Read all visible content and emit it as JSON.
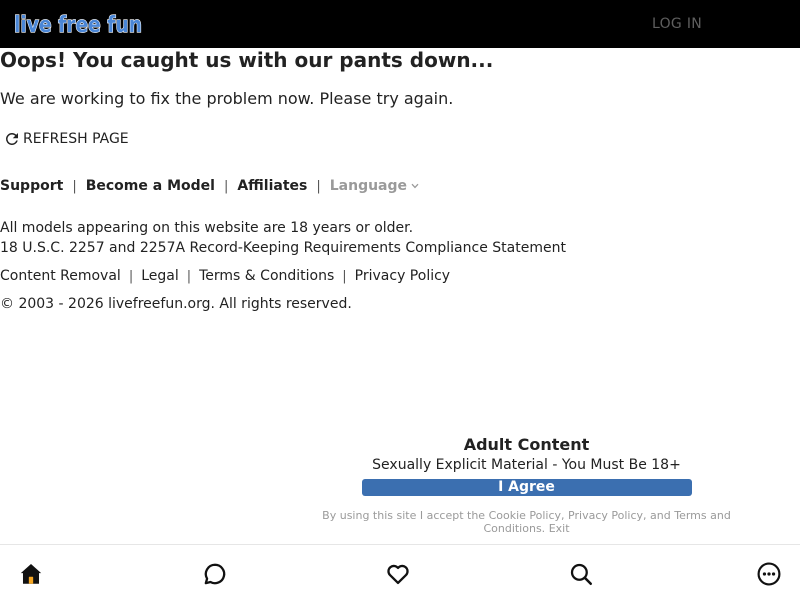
{
  "header": {
    "logo_text": "live free fun",
    "login_label": "LOG IN"
  },
  "error": {
    "title": "Oops! You caught us with our pants down...",
    "message": "We are working to fix the problem now. Please try again.",
    "refresh_label": "REFRESH PAGE"
  },
  "footer_links": {
    "support": "Support",
    "become_model": "Become a Model",
    "affiliates": "Affiliates",
    "language": "Language",
    "separator": "|"
  },
  "notices": {
    "age": "All models appearing on this website are 18 years or older.",
    "compliance": "18 U.S.C. 2257 and 2257A Record-Keeping Requirements Compliance Statement"
  },
  "legal_links": {
    "content_removal": "Content Removal",
    "legal": "Legal",
    "terms": "Terms & Conditions",
    "privacy": "Privacy Policy"
  },
  "copyright": "© 2003 - 2026 livefreefun.org. All rights reserved.",
  "consent": {
    "heading": "Adult Content",
    "subheading": "Sexually Explicit Material - You Must Be 18+",
    "agree_label": "I Agree",
    "note_prefix": "By using this site I accept the",
    "cookie_policy": "Cookie Policy",
    "comma": ",",
    "privacy_policy": "Privacy Policy",
    "and_text": ", and",
    "terms": "Terms and Conditions.",
    "exit": "Exit"
  },
  "bottom_nav": {
    "items": [
      "home-icon",
      "chat-icon",
      "heart-icon",
      "search-icon",
      "more-icon"
    ]
  },
  "colors": {
    "header_bg": "#000000",
    "agree_button": "#3b6fb0",
    "muted_text": "#9a9a9a",
    "logo_fill": "#4a86d6"
  }
}
